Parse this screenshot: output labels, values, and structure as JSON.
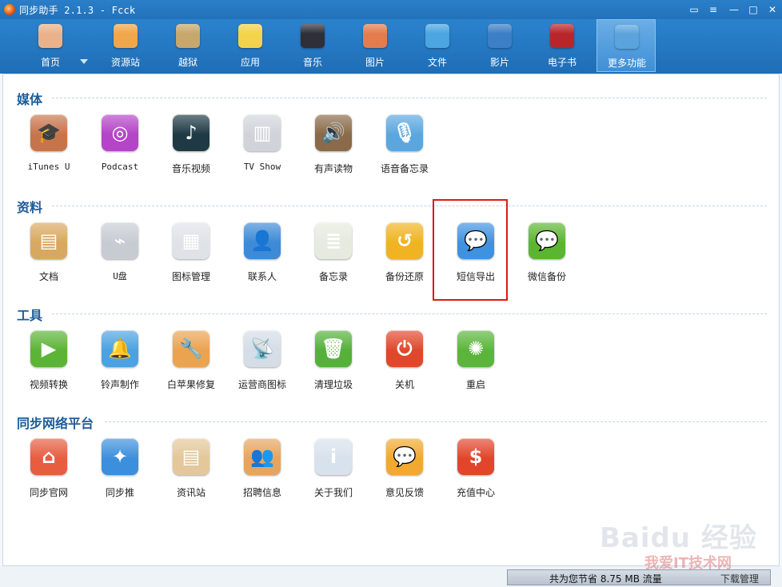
{
  "window": {
    "title": "同步助手 2.1.3 - Fcck",
    "controls": [
      "chat-icon",
      "menu-icon",
      "minimize-icon",
      "maximize-icon",
      "close-icon"
    ]
  },
  "toolbar": {
    "items": [
      {
        "label": "首页",
        "icon": "home-icon",
        "color": "#e9b28b"
      },
      {
        "label": "资源站",
        "icon": "shopping-bag-icon",
        "color": "#f0a64a"
      },
      {
        "label": "越狱",
        "icon": "pineapple-icon",
        "color": "#c7a76c"
      },
      {
        "label": "应用",
        "icon": "apps-icon",
        "color": "#f2d34b"
      },
      {
        "label": "音乐",
        "icon": "music-note-icon",
        "color": "#2f2f3a"
      },
      {
        "label": "图片",
        "icon": "picture-icon",
        "color": "#e47c4e"
      },
      {
        "label": "文件",
        "icon": "folder-icon",
        "color": "#4aa5e0"
      },
      {
        "label": "影片",
        "icon": "play-icon",
        "color": "#3c7fc6"
      },
      {
        "label": "电子书",
        "icon": "ebook-icon",
        "color": "#b8262b"
      },
      {
        "label": "更多功能",
        "icon": "tools-icon",
        "color": "#5aa3dd"
      }
    ],
    "active_index": 9
  },
  "sections": [
    {
      "title": "媒体",
      "items": [
        {
          "label": "iTunes U",
          "icon": "graduation-cap-icon",
          "color": "#c8744a",
          "glyph": "🎓"
        },
        {
          "label": "Podcast",
          "icon": "podcast-icon",
          "color": "#b444c8",
          "glyph": "◎"
        },
        {
          "label": "音乐视频",
          "icon": "music-video-icon",
          "color": "#1f3a44",
          "glyph": "♪"
        },
        {
          "label": "TV Show",
          "icon": "tv-show-icon",
          "color": "#d0d4da",
          "glyph": "▥"
        },
        {
          "label": "有声读物",
          "icon": "audiobook-icon",
          "color": "#8a6a48",
          "glyph": "🔊"
        },
        {
          "label": "语音备忘录",
          "icon": "microphone-icon",
          "color": "#5aa7e0",
          "glyph": "🎙"
        }
      ]
    },
    {
      "title": "资料",
      "items": [
        {
          "label": "文档",
          "icon": "document-tray-icon",
          "color": "#d9a860",
          "glyph": "▤"
        },
        {
          "label": "U盘",
          "icon": "usb-disk-icon",
          "color": "#c7ccd3",
          "glyph": "⌁"
        },
        {
          "label": "图标管理",
          "icon": "icon-grid-icon",
          "color": "#dfe3e8",
          "glyph": "▦"
        },
        {
          "label": "联系人",
          "icon": "contacts-icon",
          "color": "#3d8ad6",
          "glyph": "👤"
        },
        {
          "label": "备忘录",
          "icon": "notepad-icon",
          "color": "#e7eadf",
          "glyph": "≣"
        },
        {
          "label": "备份还原",
          "icon": "backup-restore-icon",
          "color": "#f0b321",
          "glyph": "↺"
        },
        {
          "label": "短信导出",
          "icon": "sms-bubble-icon",
          "color": "#3f92e0",
          "glyph": "💬"
        },
        {
          "label": "微信备份",
          "icon": "wechat-icon",
          "color": "#5cb531",
          "glyph": "💬"
        }
      ]
    },
    {
      "title": "工具",
      "items": [
        {
          "label": "视频转换",
          "icon": "video-convert-icon",
          "color": "#5cb437",
          "glyph": "▶"
        },
        {
          "label": "铃声制作",
          "icon": "bell-icon",
          "color": "#4aa2e2",
          "glyph": "🔔"
        },
        {
          "label": "白苹果修复",
          "icon": "wrench-icon",
          "color": "#eba350",
          "glyph": "🔧"
        },
        {
          "label": "运营商图标",
          "icon": "antenna-icon",
          "color": "#d5dde6",
          "glyph": "📡"
        },
        {
          "label": "清理垃圾",
          "icon": "trash-icon",
          "color": "#55b13a",
          "glyph": "🗑"
        },
        {
          "label": "关机",
          "icon": "power-icon",
          "color": "#e0482b",
          "glyph": "⏻"
        },
        {
          "label": "重启",
          "icon": "restart-icon",
          "color": "#5bb53b",
          "glyph": "✺"
        }
      ]
    },
    {
      "title": "同步网络平台",
      "items": [
        {
          "label": "同步官网",
          "icon": "house-icon",
          "color": "#e65d40",
          "glyph": "⌂"
        },
        {
          "label": "同步推",
          "icon": "tongbutui-icon",
          "color": "#3c8fdc",
          "glyph": "✦"
        },
        {
          "label": "资讯站",
          "icon": "newspaper-icon",
          "color": "#e4c79a",
          "glyph": "▤"
        },
        {
          "label": "招聘信息",
          "icon": "people-icon",
          "color": "#e5a560",
          "glyph": "👥"
        },
        {
          "label": "关于我们",
          "icon": "info-icon",
          "color": "#d8e2ec",
          "glyph": "i"
        },
        {
          "label": "意见反馈",
          "icon": "feedback-icon",
          "color": "#f2a930",
          "glyph": "💬"
        },
        {
          "label": "充值中心",
          "icon": "dollar-icon",
          "color": "#e2452b",
          "glyph": "$"
        }
      ]
    }
  ],
  "status": {
    "saved_text": "共为您节省 8.75 MB 流量",
    "right_text": "下载管理"
  },
  "watermark": {
    "line1": "Baidu 经验",
    "line2": "我爱IT技术网"
  }
}
